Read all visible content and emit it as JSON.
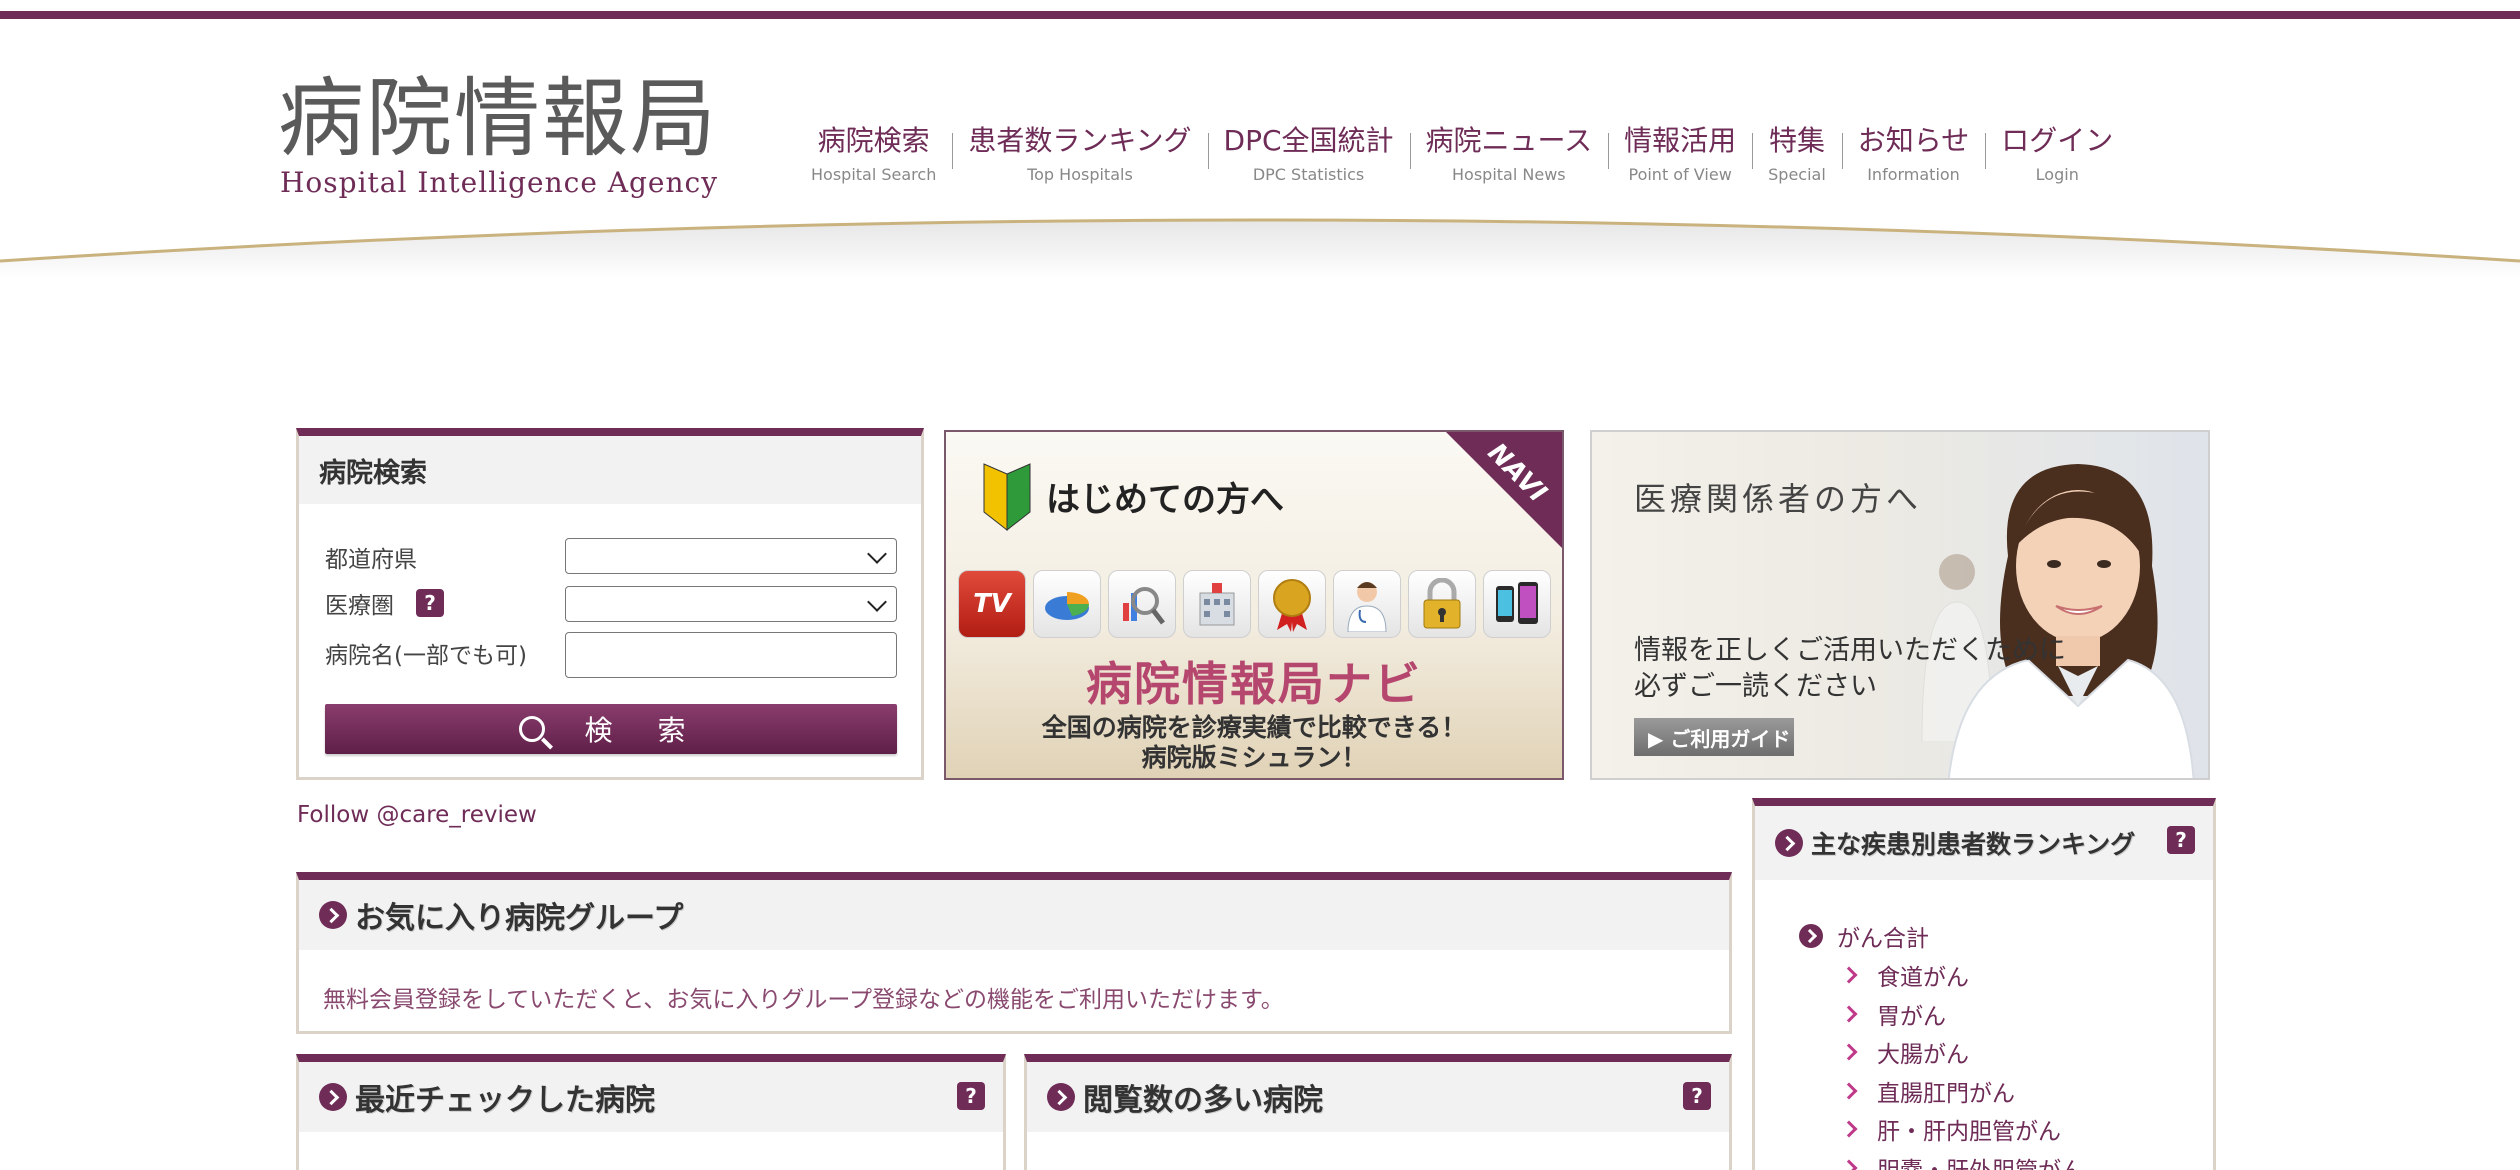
{
  "header": {
    "logo_jp": "病院情報局",
    "logo_en": "Hospital Intelligence Agency",
    "nav": [
      {
        "jp": "病院検索",
        "en": "Hospital Search"
      },
      {
        "jp": "患者数ランキング",
        "en": "Top Hospitals"
      },
      {
        "jp": "DPC全国統計",
        "en": "DPC Statistics"
      },
      {
        "jp": "病院ニュース",
        "en": "Hospital News"
      },
      {
        "jp": "情報活用",
        "en": "Point of View"
      },
      {
        "jp": "特集",
        "en": "Special"
      },
      {
        "jp": "お知らせ",
        "en": "Information"
      },
      {
        "jp": "ログイン",
        "en": "Login"
      }
    ]
  },
  "search": {
    "title": "病院検索",
    "prefecture_label": "都道府県",
    "area_label": "医療圏",
    "name_label": "病院名(一部でも可)",
    "help": "?",
    "prefecture_value": "",
    "area_value": "",
    "name_value": "",
    "button_label": "検 索"
  },
  "banner_navi": {
    "corner": "NAVI",
    "heading": "はじめての方へ",
    "tv": "TV",
    "title": "病院情報局ナビ",
    "sub1": "全国の病院を診療実績で比較できる！",
    "sub2": "病院版ミシュラン！"
  },
  "banner_med": {
    "heading": "医療関係者の方へ",
    "line1": "情報を正しくご活用いただくために",
    "line2": "必ずご一読ください",
    "button": "▶ ご利用ガイド"
  },
  "follow": "Follow @care_review",
  "favorites": {
    "title": "お気に入り病院グループ",
    "text": "無料会員登録をしていただくと、お気に入りグループ登録などの機能をご利用いただけます。"
  },
  "recent": {
    "title": "最近チェックした病院",
    "help": "?"
  },
  "popular": {
    "title": "閲覧数の多い病院",
    "help": "?"
  },
  "ranking": {
    "title": "主な疾患別患者数ランキング",
    "help": "?",
    "top": "がん合計",
    "items": [
      "食道がん",
      "胃がん",
      "大腸がん",
      "直腸肛門がん",
      "肝・肝内胆管がん",
      "胆嚢・肝外胆管がん"
    ]
  },
  "colors": {
    "brand": "#6e2c57",
    "accent_pink": "#c03a8a",
    "panel_border": "#dcd3c8"
  }
}
